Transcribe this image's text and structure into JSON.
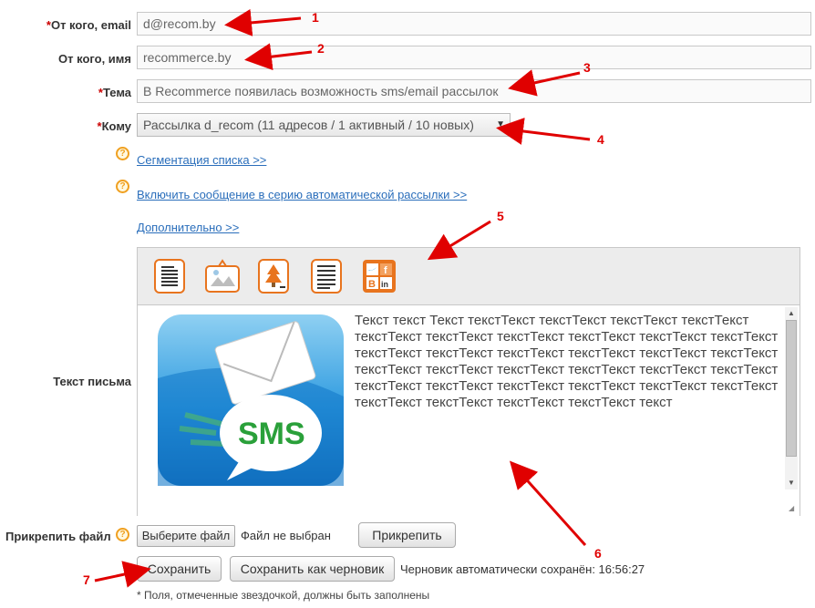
{
  "form": {
    "from_email": {
      "label": "От кого, email",
      "value": "d@recom.by"
    },
    "from_name": {
      "label": "От кого, имя",
      "value": "recommerce.by"
    },
    "subject": {
      "label": "Тема",
      "value": "В Recommerce появилась возможность sms/email рассылок"
    },
    "to": {
      "label": "Кому",
      "value": "Рассылка d_recom   (11 адресов / 1 активный / 10 новых)"
    },
    "required_mark": "*"
  },
  "links": {
    "segmentation": "Сегментация списка >>",
    "auto_series": "Включить сообщение в серию автоматической рассылки >>",
    "additional": "Дополнительно >>"
  },
  "help_icon_glyph": "?",
  "editor": {
    "label": "Текст письма",
    "image_badge": "SMS",
    "text": "Текст текст Текст текстТекст текстТекст текстТекст текстТекст текстТекст текстТекст текстТекст текстТекст текстТекст текстТекст текстТекст текстТекст текстТекст текстТекст текстТекст текстТекст текстТекст текстТекст текстТекст текстТекст текстТекст текстТекст текстТекст текстТекст текстТекст текстТекст текстТекст текстТекст текстТекст текстТекст текстТекст текстТекст текст",
    "toolbar_icons": [
      "text-template-icon",
      "image-template-icon",
      "tree-template-icon",
      "lines-template-icon",
      "social-template-icon"
    ],
    "social_letters": [
      "f",
      "B",
      "in"
    ]
  },
  "attach": {
    "label": "Прикрепить файл",
    "choose_button": "Выберите файл",
    "status": "Файл не выбран",
    "attach_button": "Прикрепить"
  },
  "actions": {
    "save": "Сохранить",
    "save_draft": "Сохранить как черновик",
    "autosave_status": "Черновик автоматически сохранён: 16:56:27"
  },
  "footnote": "* Поля, отмеченные звездочкой, должны быть заполнены",
  "annotations": [
    "1",
    "2",
    "3",
    "4",
    "5",
    "6",
    "7"
  ],
  "colors": {
    "annotation": "#e00000",
    "link": "#2a6ebb",
    "required": "#cc0000",
    "icon_orange": "#e8741e"
  }
}
